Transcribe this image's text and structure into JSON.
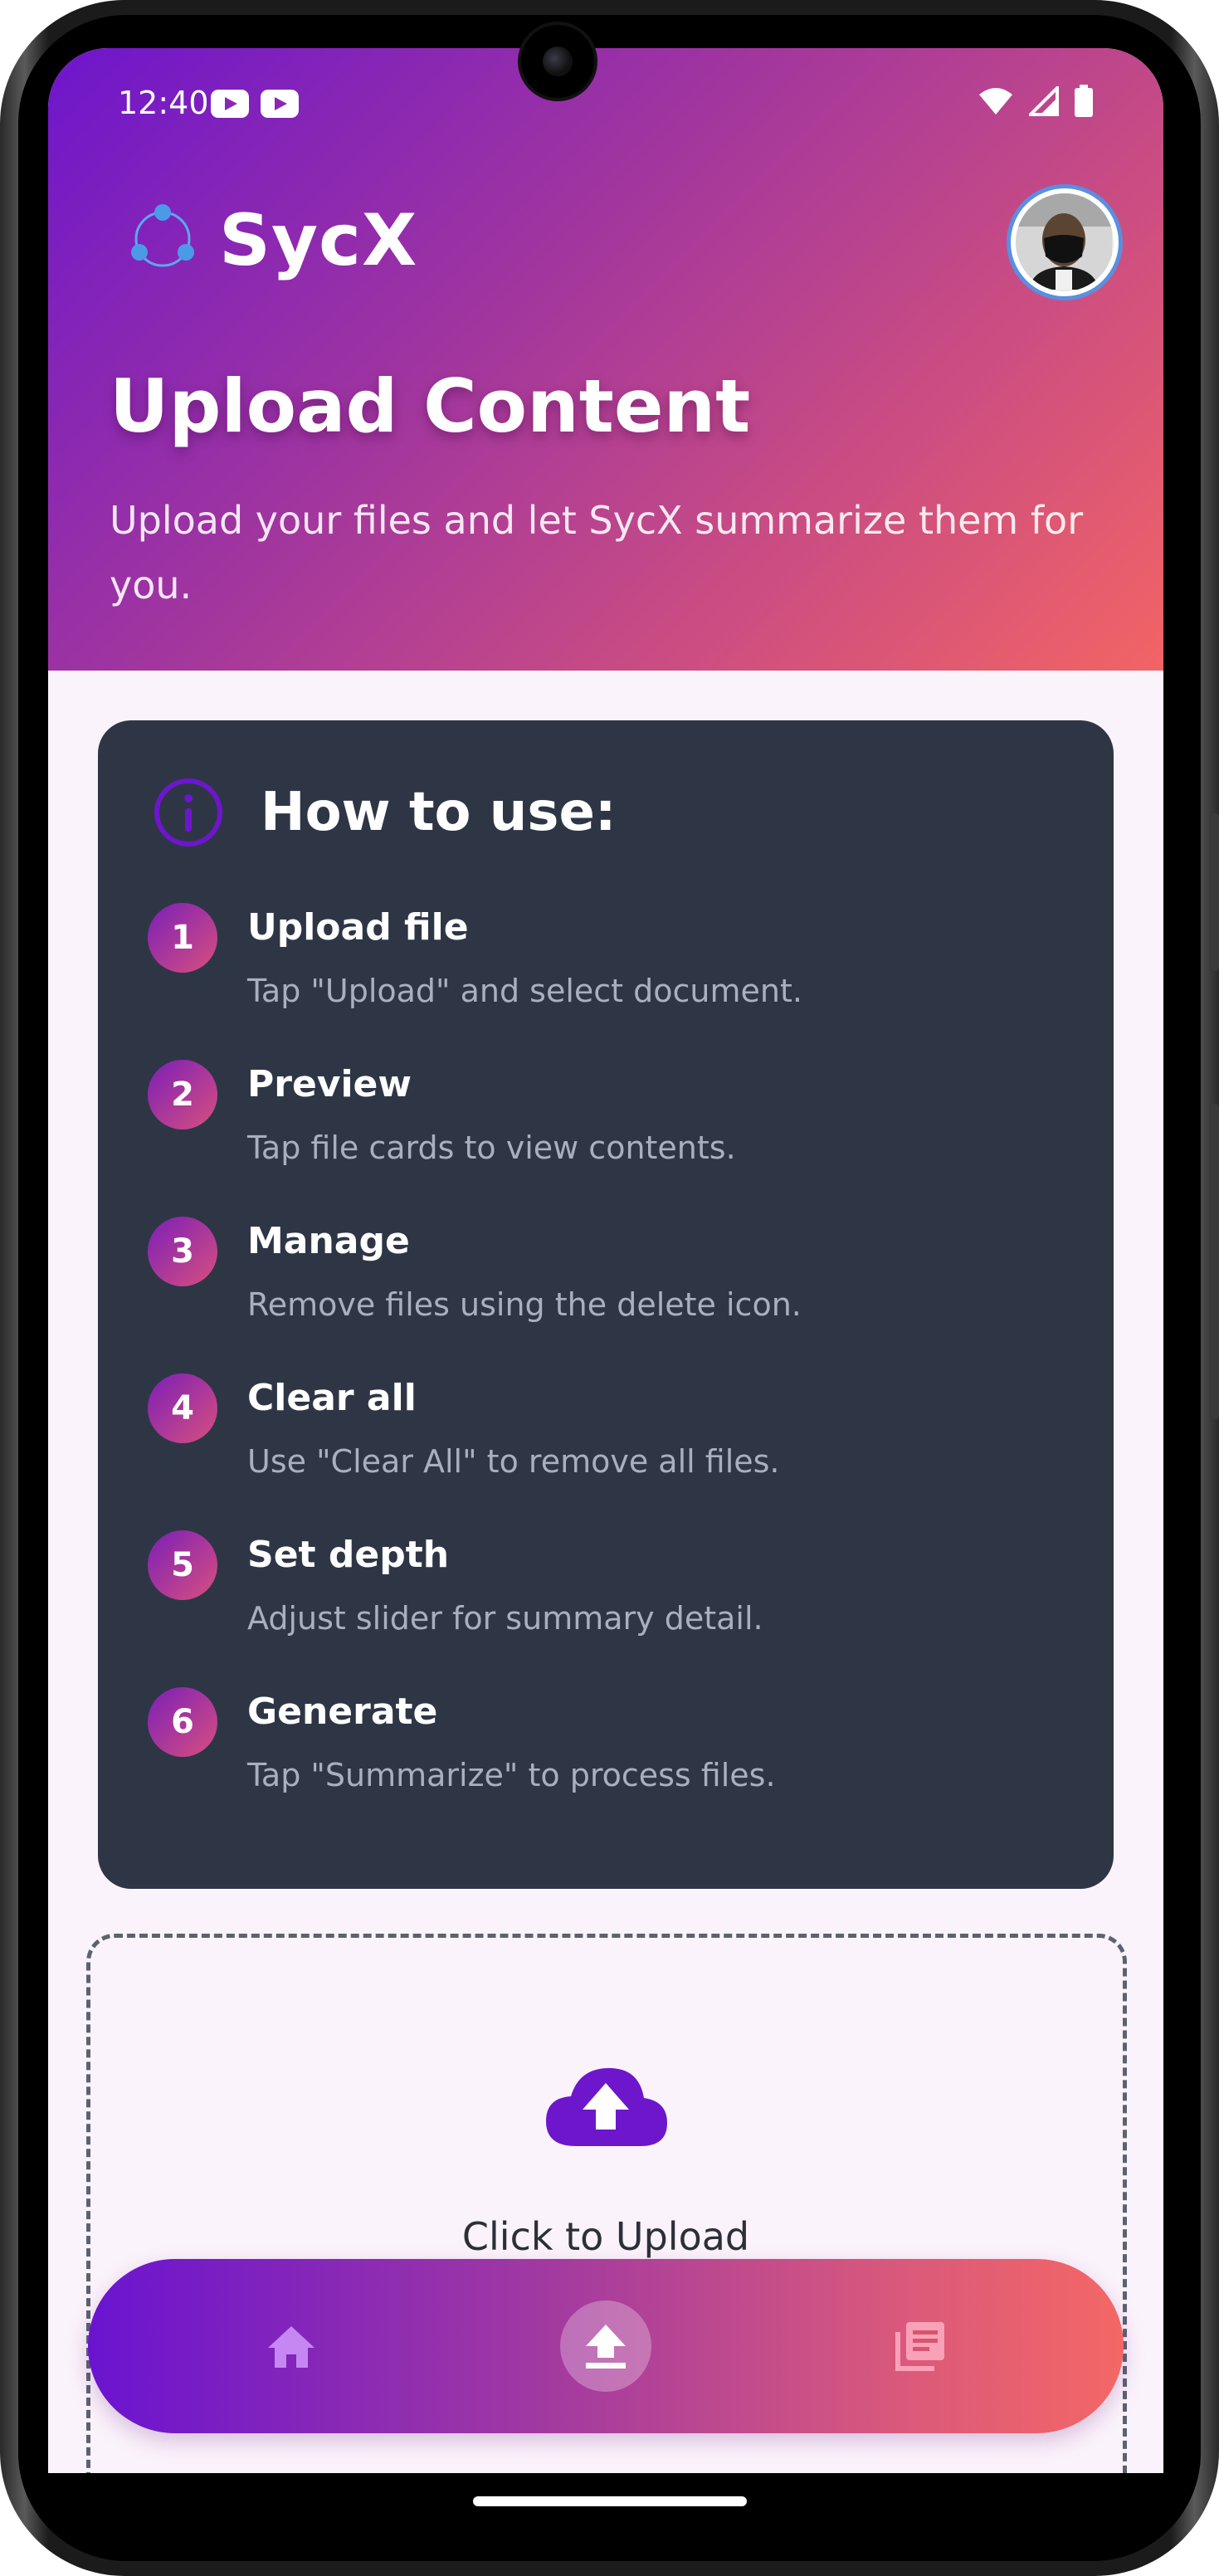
{
  "status_bar": {
    "time": "12:40",
    "notifications": [
      "youtube-icon",
      "youtube-icon"
    ],
    "right_icons": [
      "wifi-icon",
      "cellular-signal-icon",
      "battery-icon"
    ]
  },
  "app": {
    "brand_name": "SycX",
    "logo_icon": "network-nodes-icon",
    "avatar": "user-avatar"
  },
  "header": {
    "title": "Upload Content",
    "subtitle": "Upload your files and let SycX summarize them for you."
  },
  "how_to": {
    "icon": "info-icon",
    "title": "How to use:",
    "steps": [
      {
        "number": "1",
        "title": "Upload file",
        "description": "Tap \"Upload\" and select document."
      },
      {
        "number": "2",
        "title": "Preview",
        "description": "Tap file cards to view contents."
      },
      {
        "number": "3",
        "title": "Manage",
        "description": "Remove files using the delete icon."
      },
      {
        "number": "4",
        "title": "Clear all",
        "description": "Use \"Clear All\" to remove all files."
      },
      {
        "number": "5",
        "title": "Set depth",
        "description": "Adjust slider for summary detail."
      },
      {
        "number": "6",
        "title": "Generate",
        "description": "Tap \"Summarize\" to process files."
      }
    ]
  },
  "upload": {
    "icon": "cloud-upload-icon",
    "label": "Click to Upload"
  },
  "bottom_nav": {
    "items": [
      {
        "icon": "home-icon",
        "active": false
      },
      {
        "icon": "upload-icon",
        "active": true
      },
      {
        "icon": "library-icon",
        "active": false
      }
    ]
  },
  "colors": {
    "brand_purple": "#6d16cc",
    "brand_coral": "#f26464",
    "card_bg": "#2e3646",
    "screen_bg": "#fbf3fb"
  }
}
